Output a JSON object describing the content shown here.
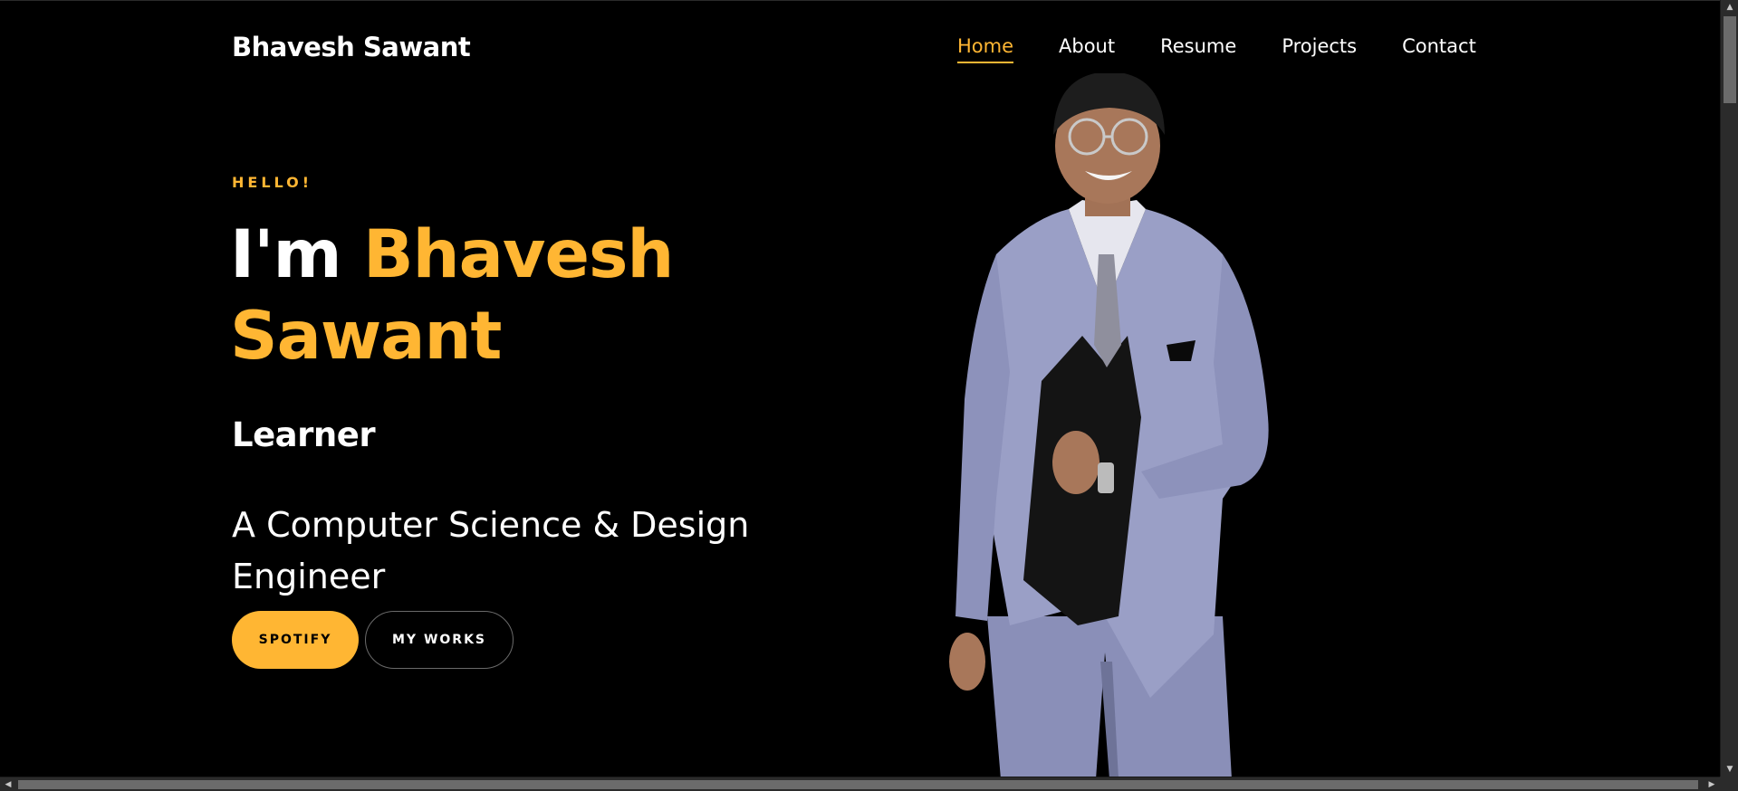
{
  "header": {
    "brand": "Bhavesh Sawant",
    "nav": [
      {
        "label": "Home",
        "active": true
      },
      {
        "label": "About",
        "active": false
      },
      {
        "label": "Resume",
        "active": false
      },
      {
        "label": "Projects",
        "active": false
      },
      {
        "label": "Contact",
        "active": false
      }
    ]
  },
  "hero": {
    "greeting": "HELLO!",
    "intro": "I'm",
    "name_line1": "Bhavesh",
    "name_line2": "Sawant",
    "role": "Learner",
    "description": "A Computer Science & Design Engineer",
    "buttons": {
      "primary": "SPOTIFY",
      "secondary": "MY WORKS"
    }
  },
  "colors": {
    "accent": "#ffb633",
    "background": "#000000",
    "text": "#ffffff"
  },
  "icons": {
    "scroll_up": "triangle-up-icon",
    "scroll_down": "triangle-down-icon",
    "scroll_left": "triangle-left-icon",
    "scroll_right": "triangle-right-icon"
  }
}
